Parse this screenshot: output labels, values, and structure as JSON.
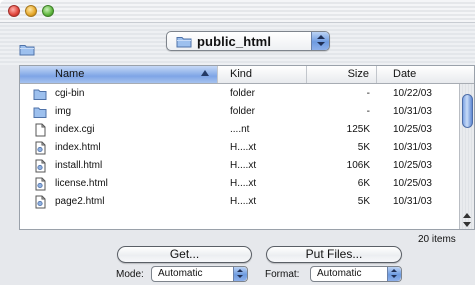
{
  "window": {
    "title": ""
  },
  "path_popup": {
    "label": "public_html"
  },
  "columns": {
    "name": "Name",
    "kind": "Kind",
    "size": "Size",
    "date": "Date"
  },
  "rows": [
    {
      "name": "cgi-bin",
      "kind": "folder",
      "size": "-",
      "date": "10/22/03",
      "icon": "folder-icon"
    },
    {
      "name": "img",
      "kind": "folder",
      "size": "-",
      "date": "10/31/03",
      "icon": "folder-icon"
    },
    {
      "name": "index.cgi",
      "kind": "....nt",
      "size": "125K",
      "date": "10/25/03",
      "icon": "document-icon"
    },
    {
      "name": "index.html",
      "kind": "H....xt",
      "size": "5K",
      "date": "10/31/03",
      "icon": "html-file-icon"
    },
    {
      "name": "install.html",
      "kind": "H....xt",
      "size": "106K",
      "date": "10/25/03",
      "icon": "html-file-icon"
    },
    {
      "name": "license.html",
      "kind": "H....xt",
      "size": "6K",
      "date": "10/25/03",
      "icon": "html-file-icon"
    },
    {
      "name": "page2.html",
      "kind": "H....xt",
      "size": "5K",
      "date": "10/31/03",
      "icon": "html-file-icon"
    }
  ],
  "item_count": "20 items",
  "buttons": {
    "get": "Get...",
    "put": "Put Files..."
  },
  "mode": {
    "label": "Mode:",
    "value": "Automatic"
  },
  "format": {
    "label": "Format:",
    "value": "Automatic"
  },
  "colors": {
    "header_selected": "#7ea5e6",
    "folder_blue": "#8fb4e8"
  }
}
